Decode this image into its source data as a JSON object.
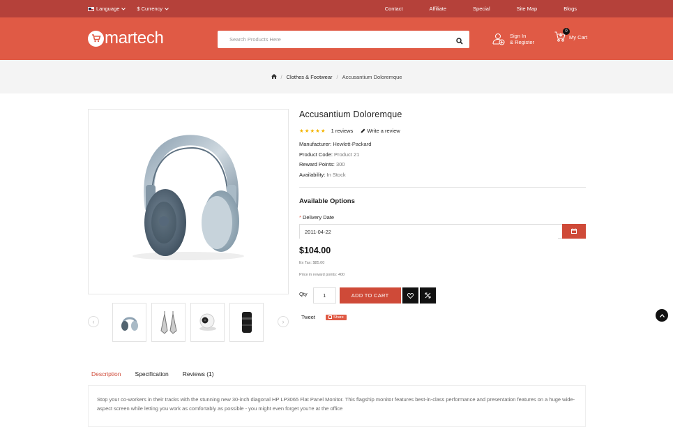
{
  "topbar": {
    "language": "Language",
    "currency": "$ Currency",
    "links": [
      "Contact",
      "Affiliate",
      "Special",
      "Site Map",
      "Blogs"
    ]
  },
  "header": {
    "logo_text": "martech",
    "search_placeholder": "Search Products Here",
    "signin_line1": "Sign In",
    "signin_line2": "& Register",
    "cart_label": "My Cart",
    "cart_count": "0"
  },
  "breadcrumb": {
    "category": "Clothes & Footwear",
    "current": "Accusantium Doloremque"
  },
  "product": {
    "title": "Accusantium Doloremque",
    "stars": "★★★★★",
    "reviews": "1 reviews",
    "write_review": "Write a review",
    "manufacturer_label": "Manufacturer:",
    "manufacturer": "Hewlett-Packard",
    "code_label": "Product Code:",
    "code": "Product 21",
    "points_label": "Reward Points:",
    "points": "300",
    "availability_label": "Availability:",
    "availability": "In Stock",
    "options_heading": "Available Options",
    "delivery_label": "Delivery Date",
    "delivery_value": "2011-04-22",
    "price": "$104.00",
    "ex_tax": "Ex Tax: $85.00",
    "price_points": "Price in reward points: 400",
    "qty_label": "Qty",
    "qty_value": "1",
    "add_to_cart": "ADD TO CART",
    "tweet": "Tweet",
    "share": "Share"
  },
  "tabs": [
    "Description",
    "Specification",
    "Reviews (1)"
  ],
  "description": "Stop your co-workers in their tracks with the stunning new 30-inch diagonal HP LP3065 Flat Panel Monitor. This flagship monitor features best-in-class performance and presentation features on a huge wide-aspect screen while letting you work as comfortably as possible - you might even forget you're at the office",
  "colors": {
    "topbar": "#b5413a",
    "header": "#e05a45",
    "accent": "#cf4a38"
  },
  "icons": [
    "flag-icon",
    "chevron-down-icon",
    "search-icon",
    "user-add-icon",
    "cart-icon",
    "home-icon",
    "pencil-icon",
    "calendar-icon",
    "heart-icon",
    "compare-icon",
    "chevron-up-icon"
  ]
}
